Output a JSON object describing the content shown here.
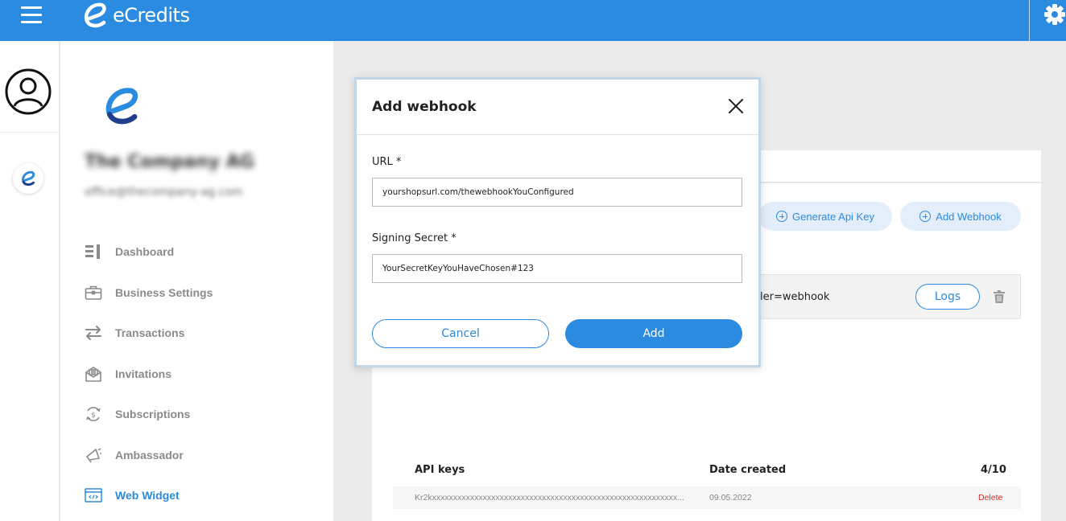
{
  "app": {
    "name": "eCredits"
  },
  "colors": {
    "primary": "#2a8be0",
    "danger": "#e02424"
  },
  "icons": {
    "menu": "hamburger-menu-icon",
    "settings": "gear-icon",
    "profile": "user-avatar-icon",
    "close": "close-icon",
    "delete": "trash-icon"
  },
  "sidebar": {
    "company_name": "The Company AG",
    "company_email": "office@thecompany-ag.com",
    "items": [
      {
        "label": "Dashboard",
        "icon": "dashboard-icon",
        "active": false
      },
      {
        "label": "Business Settings",
        "icon": "briefcase-icon",
        "active": false
      },
      {
        "label": "Transactions",
        "icon": "transfer-arrows-icon",
        "active": false
      },
      {
        "label": "Invitations",
        "icon": "mail-icon",
        "active": false
      },
      {
        "label": "Subscriptions",
        "icon": "dollar-cycle-icon",
        "active": false
      },
      {
        "label": "Ambassador",
        "icon": "megaphone-icon",
        "active": false
      },
      {
        "label": "Web Widget",
        "icon": "code-window-icon",
        "active": true
      }
    ]
  },
  "main": {
    "generate_api_key_label": "Generate Api Key",
    "add_webhook_label": "Add Webhook",
    "webhook": {
      "url_fragment": "ler=webhook",
      "logs_label": "Logs"
    },
    "api_table": {
      "headers": {
        "key": "API keys",
        "date": "Date created",
        "count": "4/10"
      },
      "rows": [
        {
          "key": "Kr2kxxxxxxxxxxxxxxxxxxxxxxxxxxxxxxxxxxxxxxxxxxxxxxxxxxxxxxxxxx...",
          "date": "09.05.2022",
          "action": "Delete"
        }
      ]
    }
  },
  "modal": {
    "title": "Add webhook",
    "url_label": "URL *",
    "url_value": "yourshopsurl.com/thewebhookYouConfigured",
    "secret_label": "Signing Secret *",
    "secret_value": "YourSecretKeyYouHaveChosen#123",
    "cancel_label": "Cancel",
    "add_label": "Add"
  }
}
